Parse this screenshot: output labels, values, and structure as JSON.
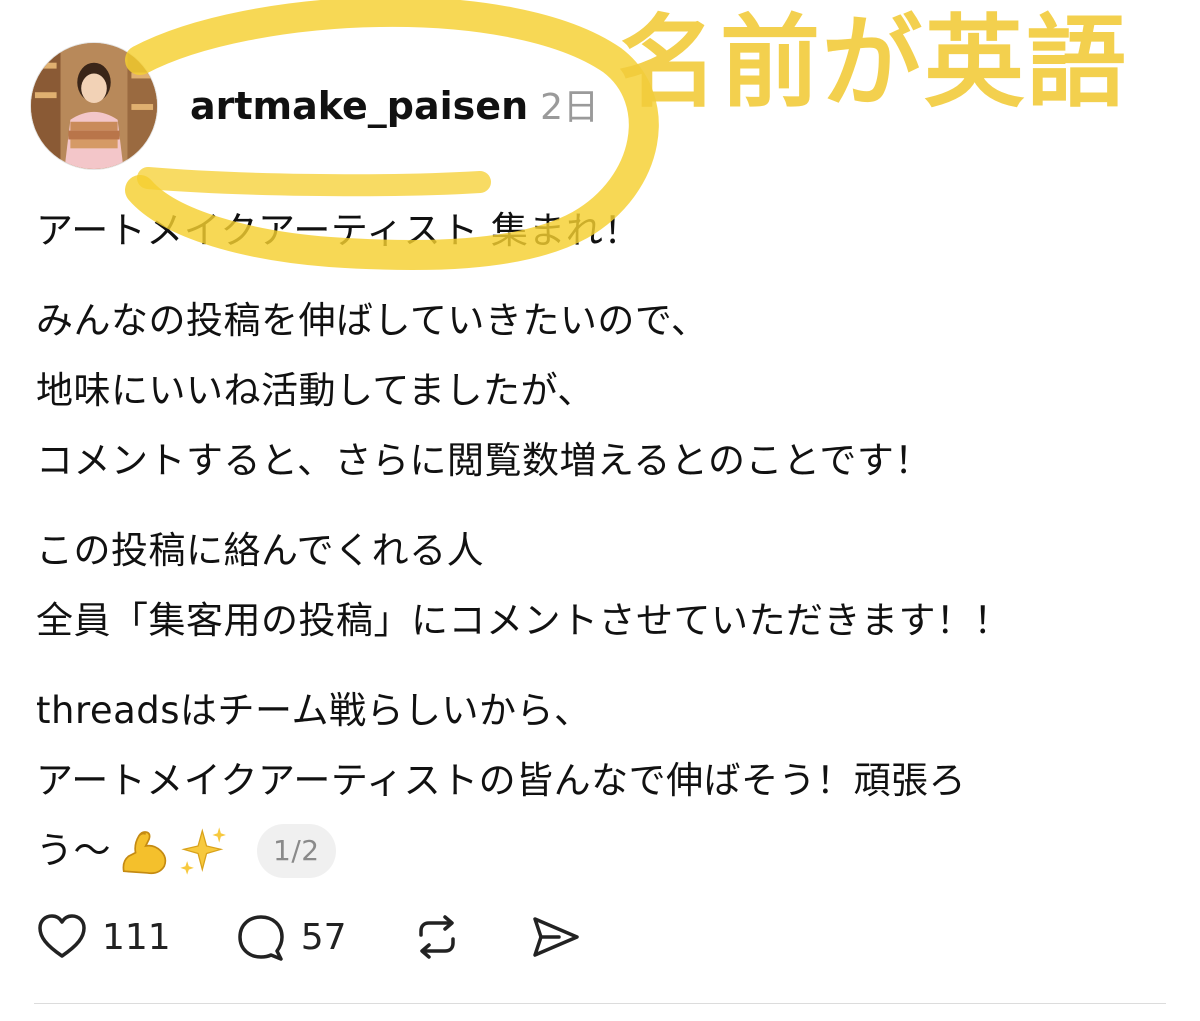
{
  "post": {
    "username": "artmake_paisen",
    "time_ago": "2日",
    "paragraphs": [
      [
        "アートメイクアーティスト 集まれ！"
      ],
      [
        "みんなの投稿を伸ばしていきたいので、",
        "地味にいいね活動してましたが、",
        "コメントすると、さらに閲覧数増えるとのことです！"
      ],
      [
        "この投稿に絡んでくれる人",
        "全員「集客用の投稿」にコメントさせていただきます！！"
      ],
      [
        "threadsはチーム戦らしいから、",
        "アートメイクアーティストの皆んなで伸ばそう！頑張ろ"
      ]
    ],
    "last_line_text": "う〜",
    "emojis": [
      "flexed-biceps-icon",
      "sparkles-icon"
    ],
    "page_indicator": "1/2"
  },
  "actions": {
    "like_count": "111",
    "reply_count": "57",
    "icons": [
      "heart-icon",
      "comment-icon",
      "repost-icon",
      "share-icon"
    ]
  },
  "annotation": {
    "text": "名前が英語",
    "color": "#f2cc3b"
  }
}
